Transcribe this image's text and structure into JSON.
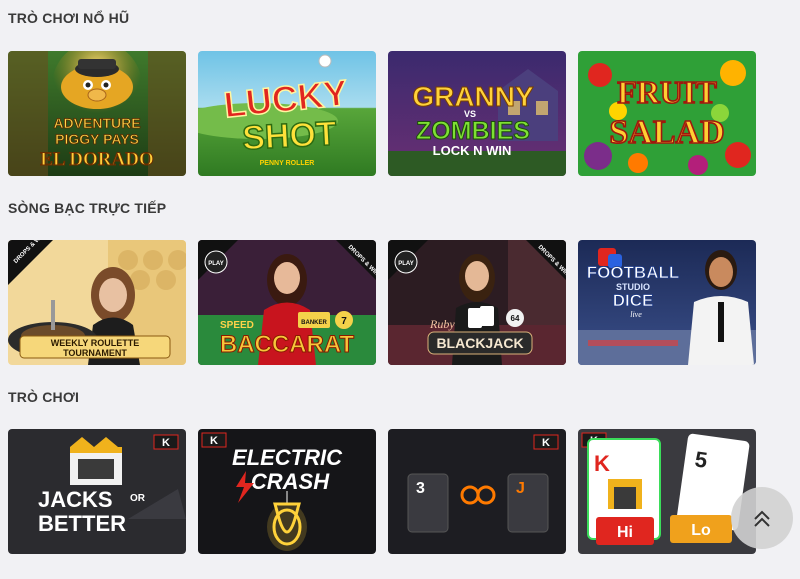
{
  "sections": [
    {
      "title": "TRÒ CHƠI NỔ HŨ",
      "games": [
        {
          "name_lines": [
            "ADVENTURE",
            "PIGGY PAYS",
            "EL DORADO"
          ]
        },
        {
          "name_lines": [
            "LUCKY",
            "SHOT"
          ],
          "tag": "PENNY ROLLER"
        },
        {
          "name_lines": [
            "GRANNY",
            "VS",
            "ZOMBIES",
            "LOCK N WIN"
          ]
        },
        {
          "name_lines": [
            "FRUIT",
            "SALAD"
          ]
        }
      ]
    },
    {
      "title": "SÒNG BẠC TRỰC TIẾP",
      "games": [
        {
          "name_lines": [
            "WEEKLY ROULETTE",
            "TOURNAMENT"
          ],
          "badge": "DROPS & WINS"
        },
        {
          "name_lines": [
            "SPEED",
            "BACCARAT"
          ],
          "badge": "DROPS & WINS",
          "play": "PLAY",
          "chips": [
            "BANKER",
            "7"
          ]
        },
        {
          "name_lines": [
            "Ruby",
            "BLACKJACK"
          ],
          "badge": "DROPS & WINS",
          "play": "PLAY",
          "number": "64"
        },
        {
          "name_lines": [
            "FOOTBALL",
            "STUDIO",
            "DICE",
            "live"
          ]
        }
      ]
    },
    {
      "title": "TRÒ CHƠI",
      "games": [
        {
          "name_lines": [
            "JACKS",
            "OR",
            "BETTER"
          ],
          "logo": "K"
        },
        {
          "name_lines": [
            "ELECTRIC",
            "CRASH"
          ],
          "logo": "K"
        },
        {
          "cards": [
            "3",
            "J"
          ],
          "logo": "K"
        },
        {
          "cards": [
            "K",
            "5"
          ],
          "buttons": [
            "Hi",
            "Lo"
          ],
          "logo": "K"
        }
      ]
    }
  ],
  "scroll_top": {
    "icon": "double-chevron-up-icon"
  },
  "colors": {
    "background": "#f1f1f4",
    "title": "#3a3a3a"
  }
}
